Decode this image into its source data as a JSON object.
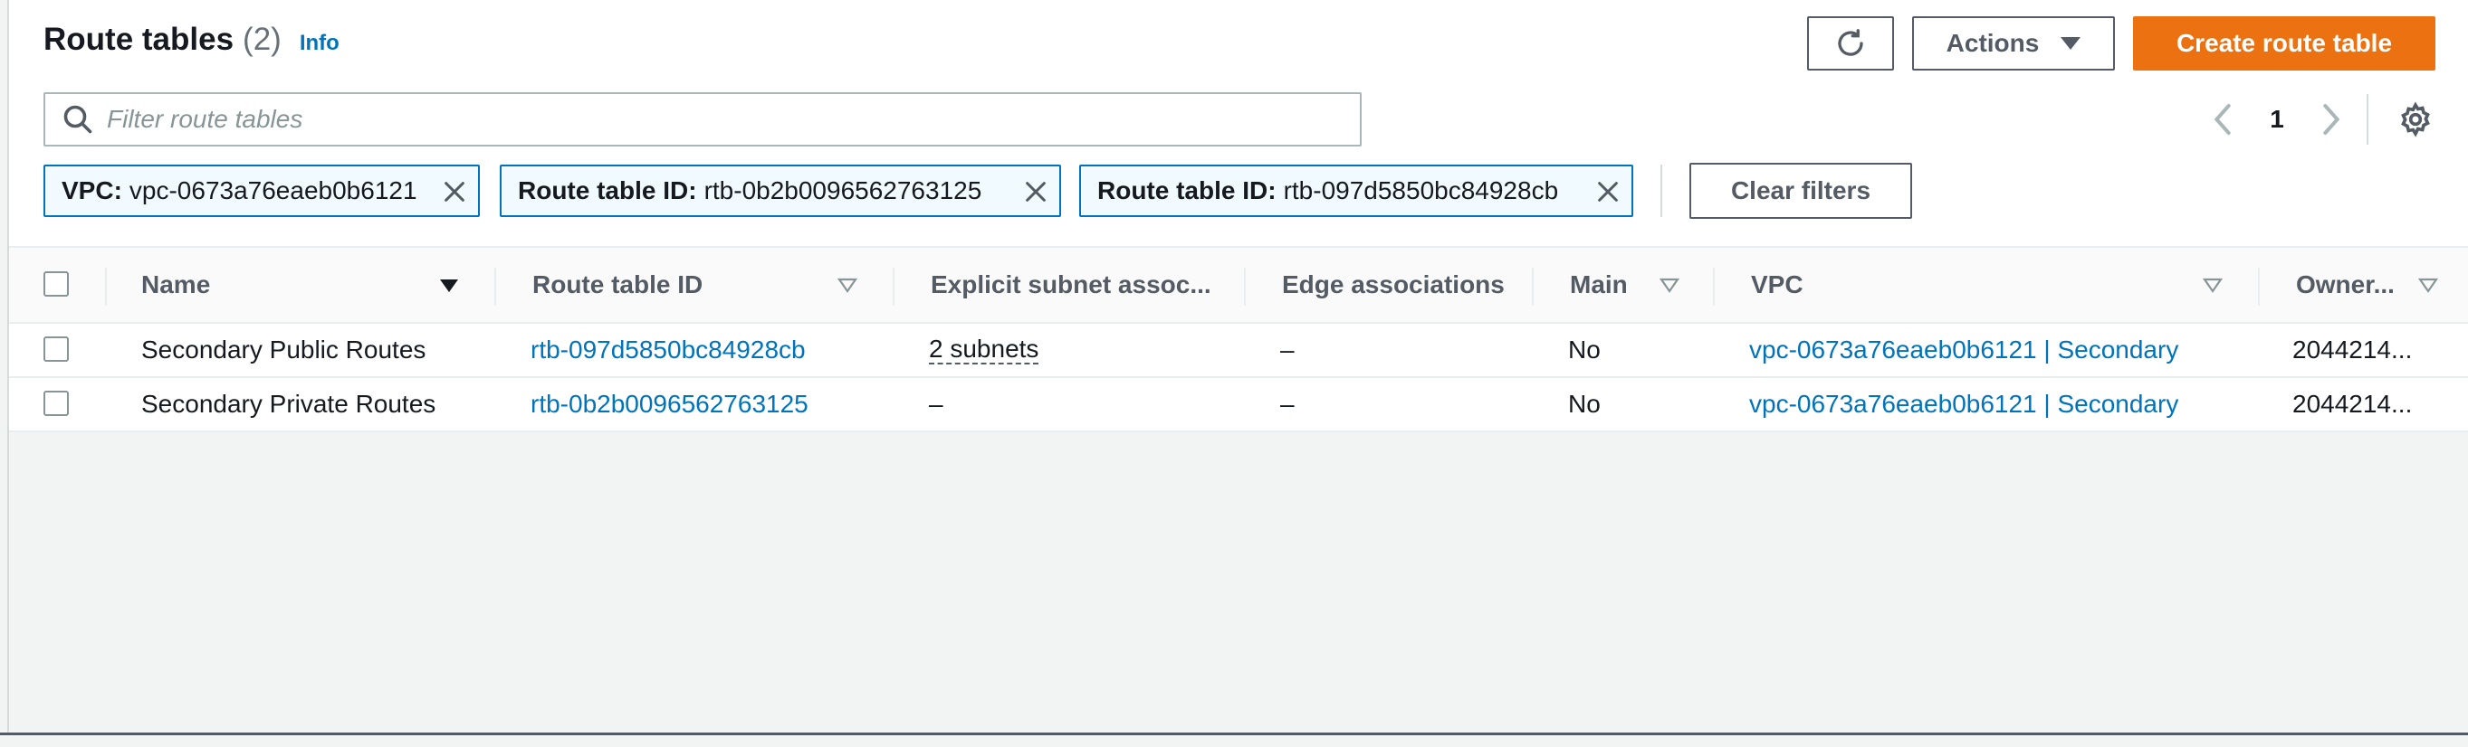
{
  "header": {
    "title": "Route tables",
    "count": "(2)",
    "info": "Info",
    "actions_label": "Actions",
    "create_label": "Create route table"
  },
  "search": {
    "placeholder": "Filter route tables",
    "value": ""
  },
  "pagination": {
    "current_page": "1"
  },
  "filters": [
    {
      "key": "VPC:",
      "value": "vpc-0673a76eaeb0b6121"
    },
    {
      "key": "Route table ID:",
      "value": "rtb-0b2b0096562763125"
    },
    {
      "key": "Route table ID:",
      "value": "rtb-097d5850bc84928cb"
    }
  ],
  "clear_filters_label": "Clear filters",
  "table": {
    "columns": [
      "Name",
      "Route table ID",
      "Explicit subnet assoc...",
      "Edge associations",
      "Main",
      "VPC",
      "Owner..."
    ],
    "rows": [
      {
        "name": "Secondary Public Routes",
        "route_table_id": "rtb-097d5850bc84928cb",
        "explicit_subnet": "2 subnets",
        "edge": "–",
        "main": "No",
        "vpc": "vpc-0673a76eaeb0b6121 | Secondary",
        "owner": "2044214..."
      },
      {
        "name": "Secondary Private Routes",
        "route_table_id": "rtb-0b2b0096562763125",
        "explicit_subnet": "–",
        "edge": "–",
        "main": "No",
        "vpc": "vpc-0673a76eaeb0b6121 | Secondary",
        "owner": "2044214..."
      }
    ]
  },
  "colors": {
    "primary": "#ec7211",
    "link": "#0073bb",
    "token_bg": "#f1faff"
  },
  "icons": [
    "refresh-icon",
    "caret-down-icon",
    "search-icon",
    "chevron-left-icon",
    "chevron-right-icon",
    "settings-gear-icon",
    "close-icon",
    "sort-descending-icon",
    "sort-icon"
  ]
}
